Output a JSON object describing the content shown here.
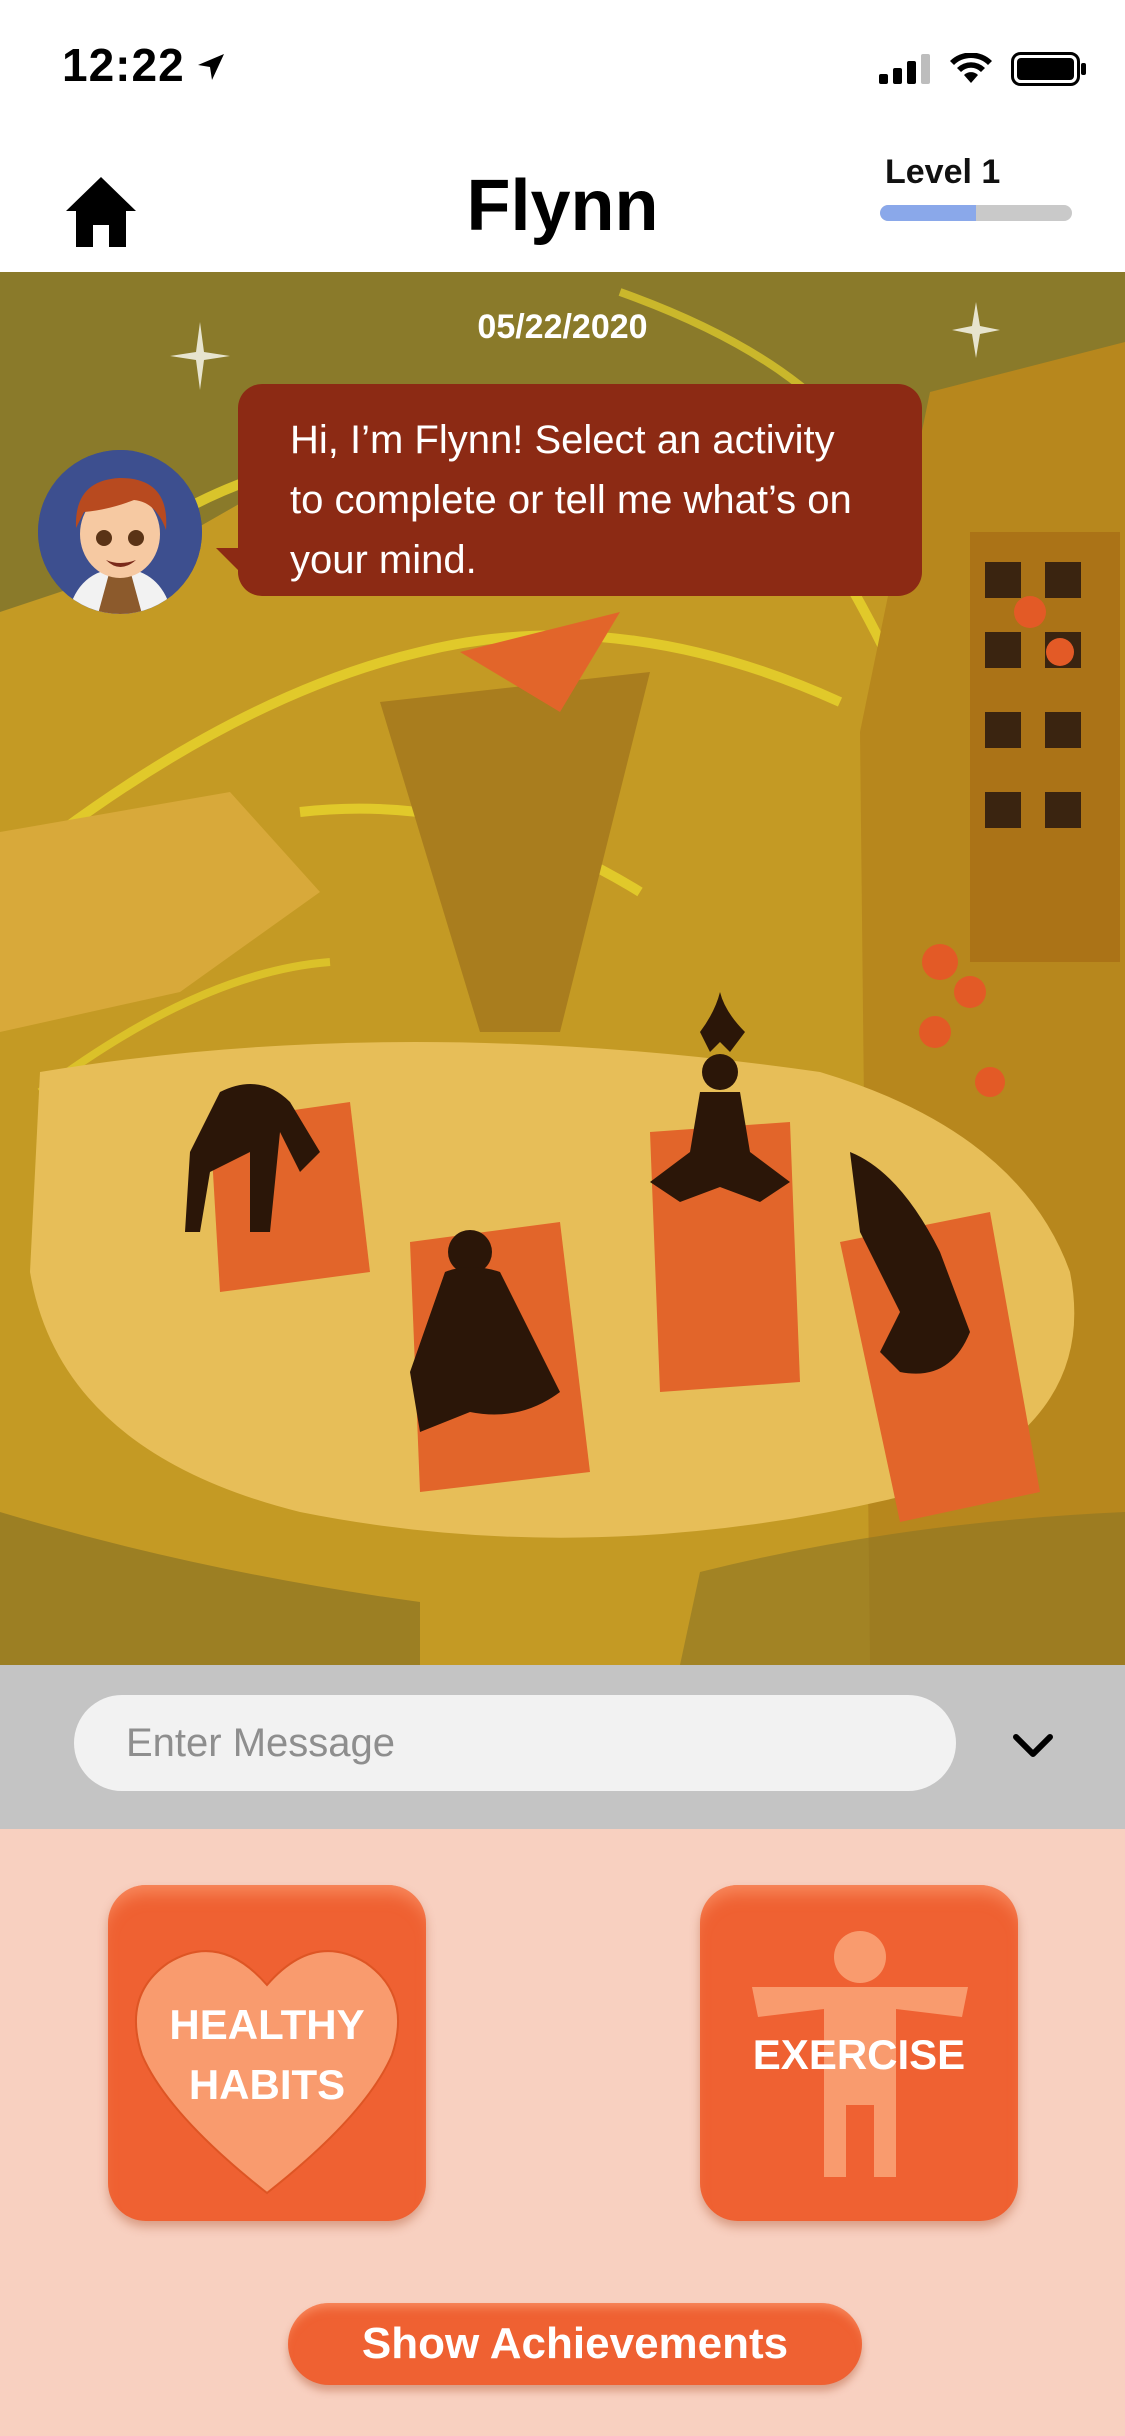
{
  "status_bar": {
    "time": "12:22",
    "icons": [
      "location-arrow-icon",
      "signal-bars-icon",
      "wifi-icon",
      "battery-icon"
    ]
  },
  "header": {
    "title": "Flynn",
    "level_label": "Level 1",
    "level_progress": 0.5,
    "home_icon": "home-icon"
  },
  "chat": {
    "date": "05/22/2020",
    "bot_message_lines": [
      "Hi, I’m Flynn! Select an activity",
      "to complete or tell me what’s on",
      "your mind."
    ]
  },
  "input": {
    "placeholder": "Enter Message",
    "toggle_icon": "chevron-down-icon"
  },
  "activities": [
    {
      "label_lines": [
        "HEALTHY",
        "HABITS"
      ],
      "icon": "heart-icon"
    },
    {
      "label": "EXERCISE",
      "icon": "person-icon"
    }
  ],
  "achievements_button": "Show Achievements",
  "colors": {
    "accent": "#ef6132",
    "bubble": "#8c2a14",
    "level_fill": "#8aa8ea",
    "activity_bg": "#f8d0c0",
    "input_bar": "#c4c4c4"
  }
}
